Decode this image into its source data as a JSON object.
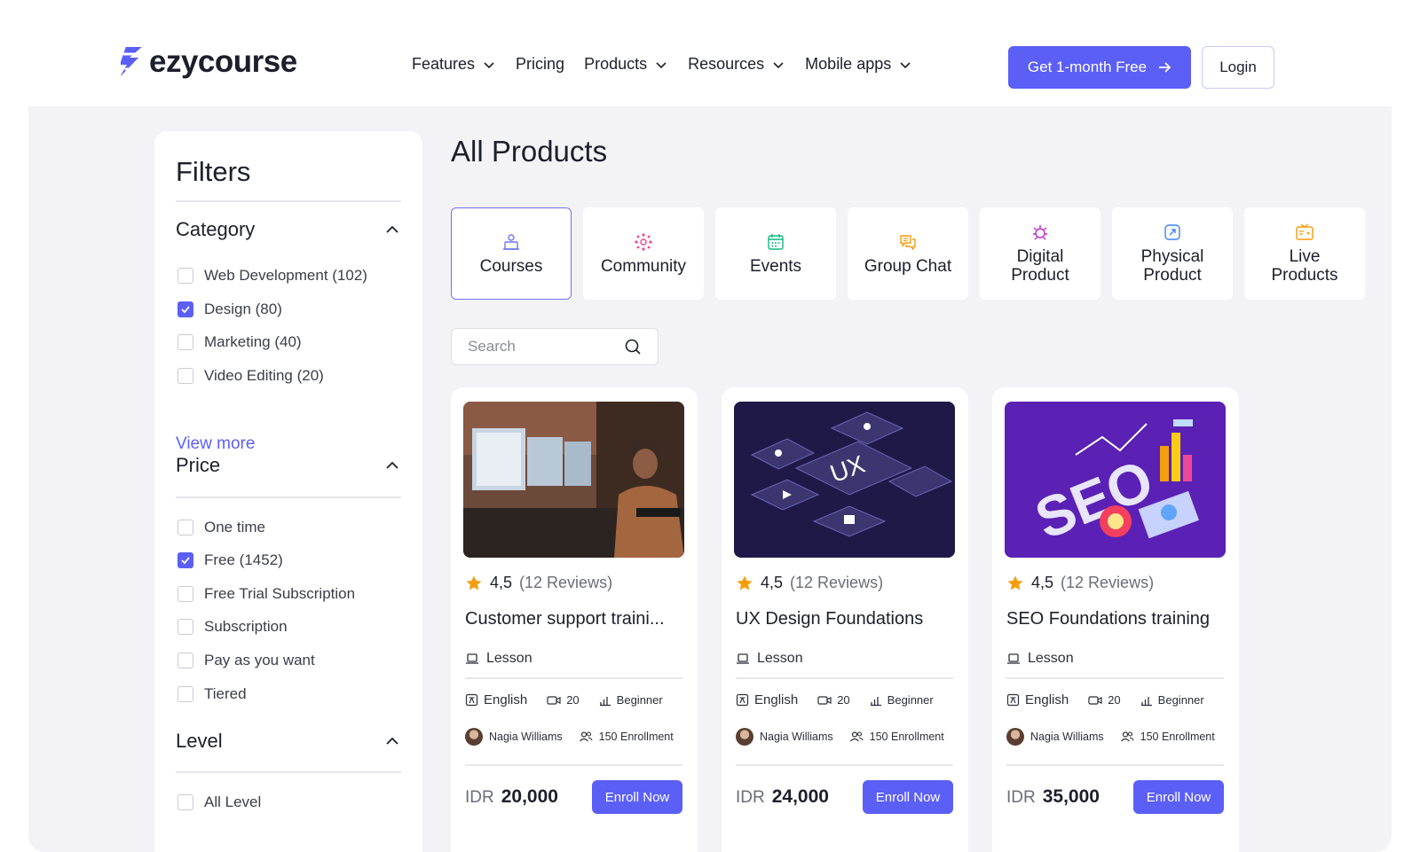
{
  "brand": {
    "name": "ezycourse"
  },
  "nav": {
    "items": [
      {
        "label": "Features",
        "dropdown": true
      },
      {
        "label": "Pricing",
        "dropdown": false
      },
      {
        "label": "Products",
        "dropdown": true
      },
      {
        "label": "Resources",
        "dropdown": true
      },
      {
        "label": "Mobile apps",
        "dropdown": true
      }
    ],
    "cta_label": "Get 1-month Free",
    "login_label": "Login"
  },
  "filters": {
    "title": "Filters",
    "sections": [
      {
        "title": "Category",
        "options": [
          {
            "label": "Web Development (102)",
            "checked": false
          },
          {
            "label": "Design (80)",
            "checked": true
          },
          {
            "label": "Marketing (40)",
            "checked": false
          },
          {
            "label": "Video Editing (20)",
            "checked": false
          }
        ],
        "view_more": "View more"
      },
      {
        "title": "Price",
        "options": [
          {
            "label": "One time",
            "checked": false
          },
          {
            "label": "Free (1452)",
            "checked": true
          },
          {
            "label": "Free Trial Subscription",
            "checked": false
          },
          {
            "label": "Subscription",
            "checked": false
          },
          {
            "label": "Pay as you want",
            "checked": false
          },
          {
            "label": "Tiered",
            "checked": false
          }
        ]
      },
      {
        "title": "Level",
        "options": [
          {
            "label": "All Level",
            "checked": false
          }
        ]
      }
    ]
  },
  "main": {
    "title": "All Products",
    "tabs": [
      {
        "label": "Courses",
        "icon": "courses-icon",
        "active": true
      },
      {
        "label": "Community",
        "icon": "community-icon",
        "active": false
      },
      {
        "label": "Events",
        "icon": "calendar-icon",
        "active": false
      },
      {
        "label": "Group Chat",
        "icon": "chat-icon",
        "active": false
      },
      {
        "label": "Digital\nProduct",
        "icon": "digital-product-icon",
        "active": false
      },
      {
        "label": "Physical\nProduct",
        "icon": "physical-product-icon",
        "active": false
      },
      {
        "label": "Live\nProducts",
        "icon": "live-products-icon",
        "active": false
      }
    ],
    "search": {
      "placeholder": "Search",
      "value": ""
    },
    "cards": [
      {
        "rating": "4,5",
        "reviews": "(12 Reviews)",
        "title": "Customer support traini...",
        "type": "Lesson",
        "language": "English",
        "videos": "20",
        "level": "Beginner",
        "author": "Nagia Williams",
        "enrollment": "150 Enrollment",
        "currency": "IDR",
        "price": "20,000",
        "button": "Enroll Now"
      },
      {
        "rating": "4,5",
        "reviews": "(12 Reviews)",
        "title": "UX Design Foundations",
        "type": "Lesson",
        "language": "English",
        "videos": "20",
        "level": "Beginner",
        "author": "Nagia Williams",
        "enrollment": "150 Enrollment",
        "currency": "IDR",
        "price": "24,000",
        "button": "Enroll Now"
      },
      {
        "rating": "4,5",
        "reviews": "(12 Reviews)",
        "title": "SEO Foundations training",
        "type": "Lesson",
        "language": "English",
        "videos": "20",
        "level": "Beginner",
        "author": "Nagia Williams",
        "enrollment": "150 Enrollment",
        "currency": "IDR",
        "price": "35,000",
        "button": "Enroll Now"
      }
    ]
  },
  "colors": {
    "accent": "#5b5ff6",
    "text": "#1d1f2c",
    "muted": "#6b6d7a",
    "background": "#f3f3f5",
    "star": "#f59e0b"
  }
}
